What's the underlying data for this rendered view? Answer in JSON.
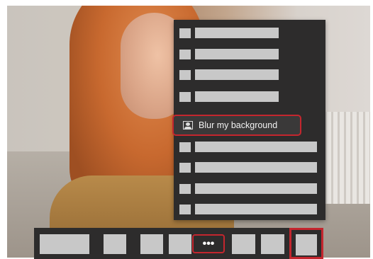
{
  "menu": {
    "highlighted_item": {
      "icon": "blur-background-icon",
      "label": "Blur my background"
    }
  },
  "controlbar": {
    "more_label": "•••"
  },
  "colors": {
    "menu_bg": "#2d2c2c",
    "placeholder": "#c8c8c8",
    "accent_red": "#c4262e"
  }
}
